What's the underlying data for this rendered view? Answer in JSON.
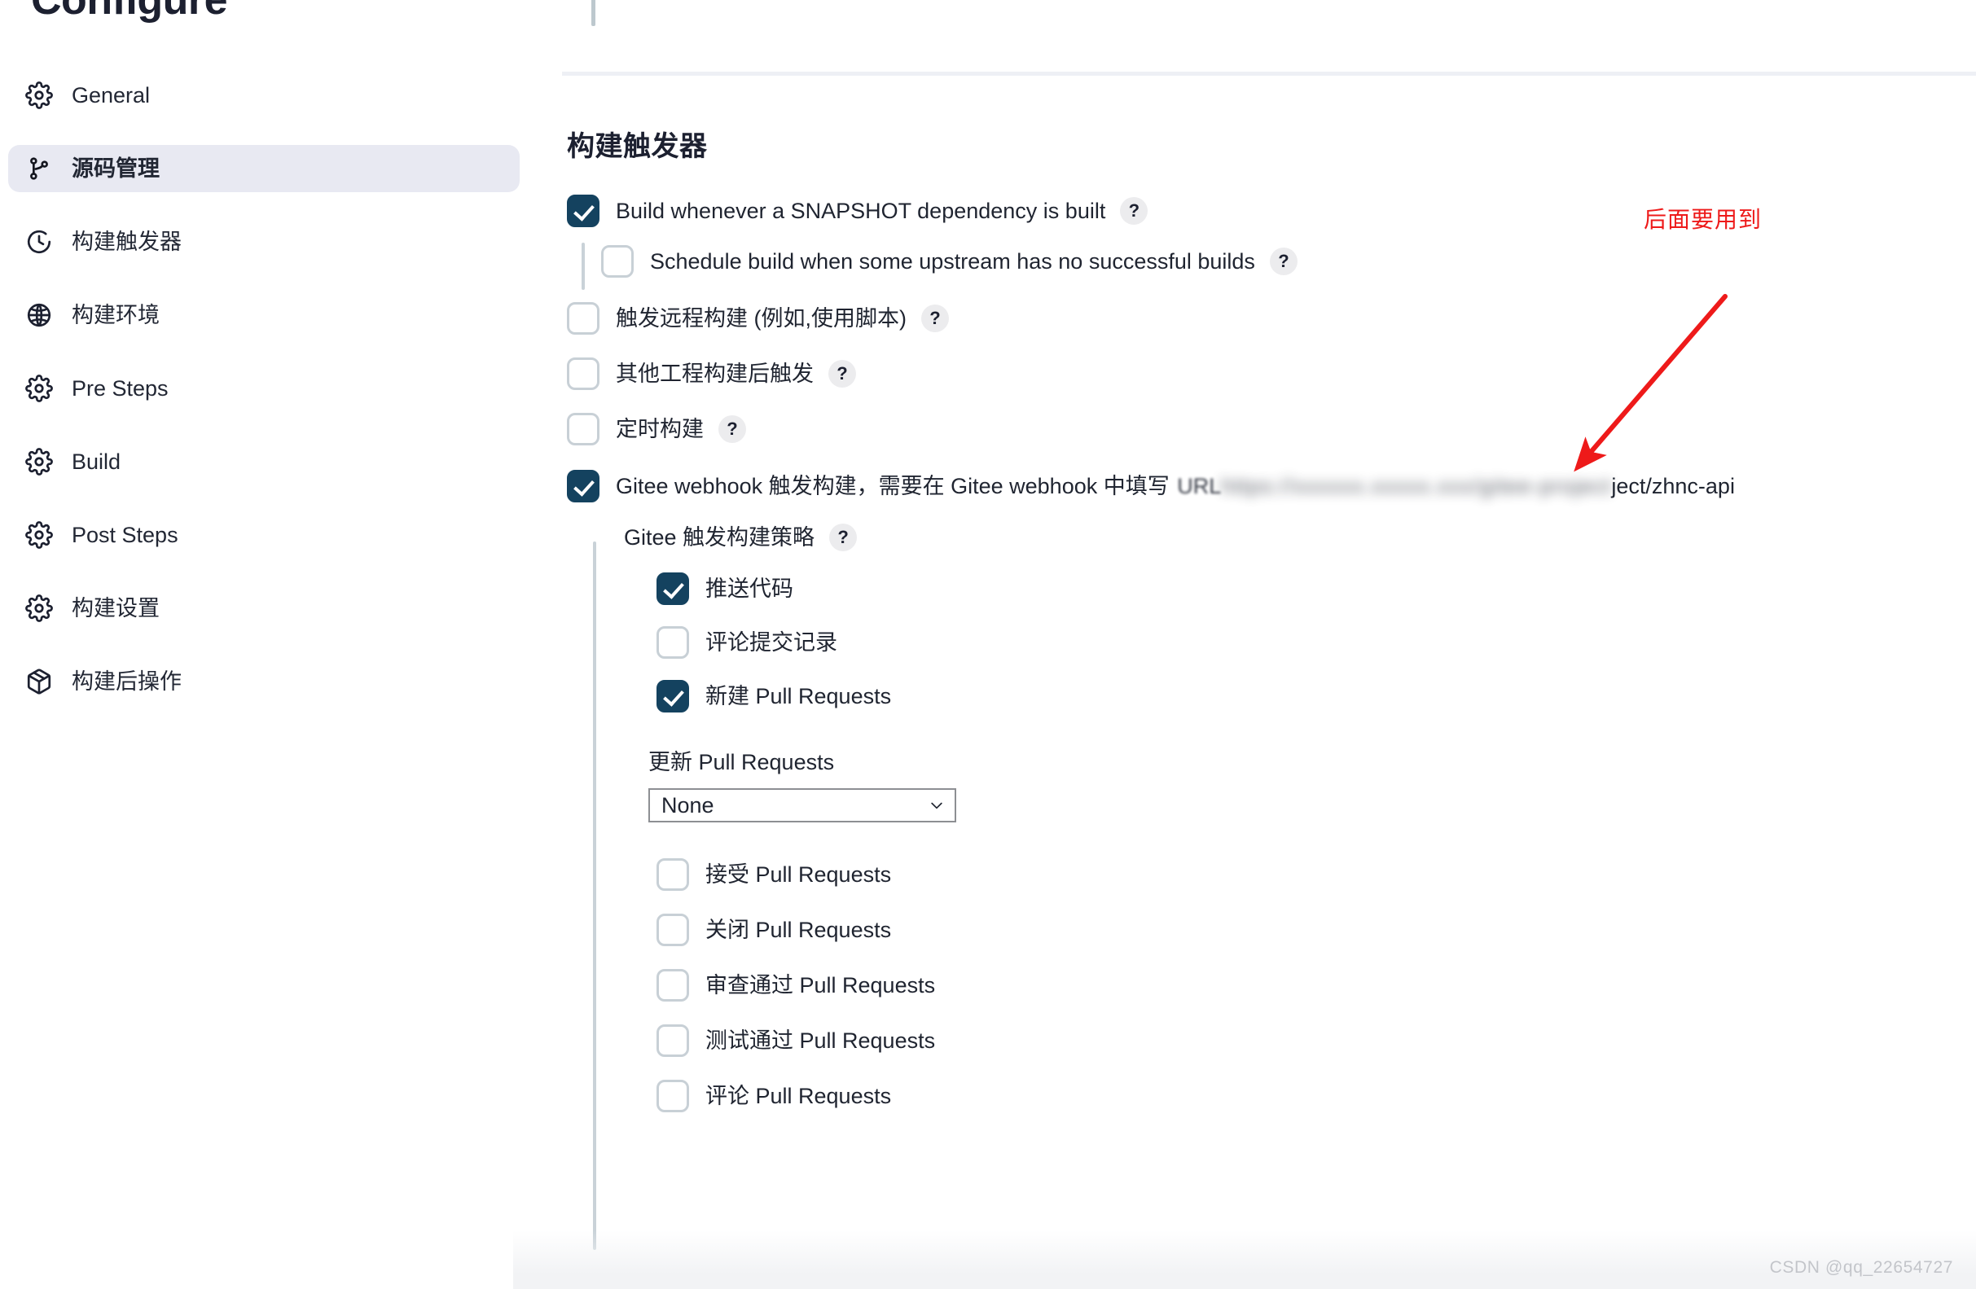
{
  "page": {
    "title": "Configure",
    "watermark": "CSDN @qq_22654727"
  },
  "sidebar": {
    "items": [
      {
        "label": "General",
        "icon": "gear-icon",
        "selected": false
      },
      {
        "label": "源码管理",
        "icon": "branch-icon",
        "selected": true
      },
      {
        "label": "构建触发器",
        "icon": "clock-icon",
        "selected": false
      },
      {
        "label": "构建环境",
        "icon": "globe-icon",
        "selected": false
      },
      {
        "label": "Pre Steps",
        "icon": "gear-icon",
        "selected": false
      },
      {
        "label": "Build",
        "icon": "gear-icon",
        "selected": false
      },
      {
        "label": "Post Steps",
        "icon": "gear-icon",
        "selected": false
      },
      {
        "label": "构建设置",
        "icon": "gear-icon",
        "selected": false
      },
      {
        "label": "构建后操作",
        "icon": "package-icon",
        "selected": false
      }
    ]
  },
  "main": {
    "section_title": "构建触发器",
    "help_glyph": "?",
    "triggers": [
      {
        "label": "Build whenever a SNAPSHOT dependency is built",
        "checked": true,
        "help": true
      },
      {
        "label": "Schedule build when some upstream has no successful builds",
        "checked": false,
        "help": true
      },
      {
        "label": "触发远程构建 (例如,使用脚本)",
        "checked": false,
        "help": true
      },
      {
        "label": "其他工程构建后触发",
        "checked": false,
        "help": true
      },
      {
        "label": "定时构建",
        "checked": false,
        "help": true
      }
    ],
    "gitee": {
      "label_prefix": "Gitee webhook 触发构建，需要在 Gitee webhook 中填写 ",
      "url_visible_head": "URL",
      "url_masked": "https://xxxxxx.xxxxx.xxx/gitee-project",
      "url_visible_tail": "ject/zhnc-api",
      "checked": true,
      "strategy_label": "Gitee 触发构建策略",
      "options": [
        {
          "label": "推送代码",
          "checked": true
        },
        {
          "label": "评论提交记录",
          "checked": false
        },
        {
          "label": "新建 Pull Requests",
          "checked": true
        }
      ],
      "update_pr_label": "更新 Pull Requests",
      "update_pr_value": "None",
      "update_pr_options": [
        "None"
      ],
      "pr_actions": [
        {
          "label": "接受 Pull Requests",
          "checked": false
        },
        {
          "label": "关闭 Pull Requests",
          "checked": false
        },
        {
          "label": "审查通过 Pull Requests",
          "checked": false
        },
        {
          "label": "测试通过 Pull Requests",
          "checked": false
        },
        {
          "label": "评论 Pull Requests",
          "checked": false
        }
      ]
    }
  },
  "annotation": {
    "text": "后面要用到",
    "color": "#ee1a1a"
  },
  "colors": {
    "checkbox_checked": "#14425f",
    "checkbox_border": "#c8d0d6",
    "sidebar_selected_bg": "#e8e9f2",
    "annotation_red": "#ee1a1a",
    "guide_line": "#c9d2d8"
  }
}
